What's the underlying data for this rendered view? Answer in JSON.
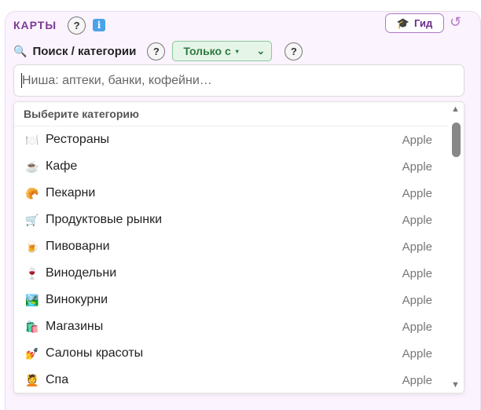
{
  "header": {
    "title": "КАРТЫ",
    "help_label": "?",
    "info_label": "i",
    "guide_label": "Гид",
    "guide_icon": "🎓",
    "refresh_icon": "↺"
  },
  "search": {
    "icon": "🔍",
    "label": "Поиск / категории",
    "help_label": "?",
    "filter_value": "Только с",
    "filter_caret": "▾",
    "filter_chevron": "⌄",
    "filter_help": "?",
    "placeholder": "Ниша: аптеки, банки, кофейни…"
  },
  "dropdown": {
    "header": "Выберите категорию",
    "items": [
      {
        "emoji": "🍽️",
        "label": "Рестораны",
        "source": "Apple"
      },
      {
        "emoji": "☕",
        "label": "Кафе",
        "source": "Apple"
      },
      {
        "emoji": "🥐",
        "label": "Пекарни",
        "source": "Apple"
      },
      {
        "emoji": "🛒",
        "label": "Продуктовые рынки",
        "source": "Apple"
      },
      {
        "emoji": "🍺",
        "label": "Пивоварни",
        "source": "Apple"
      },
      {
        "emoji": "🍷",
        "label": "Винодельни",
        "source": "Apple"
      },
      {
        "emoji": "🏞️",
        "label": "Винокурни",
        "source": "Apple"
      },
      {
        "emoji": "🛍️",
        "label": "Магазины",
        "source": "Apple"
      },
      {
        "emoji": "💅",
        "label": "Салоны красоты",
        "source": "Apple"
      },
      {
        "emoji": "💆",
        "label": "Спа",
        "source": "Apple"
      }
    ],
    "scroll_up": "▲",
    "scroll_down": "▼"
  }
}
